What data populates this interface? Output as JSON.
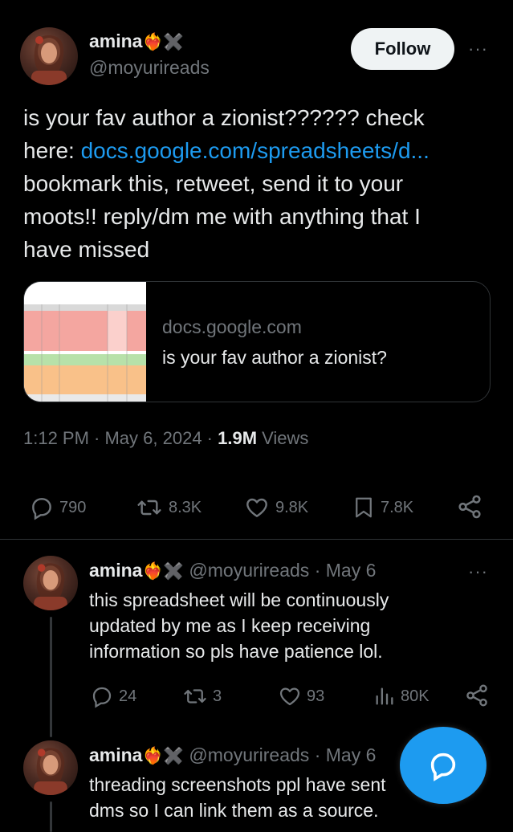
{
  "main_tweet": {
    "author_name": "amina",
    "author_emoji": "❤️‍🔥✖️",
    "handle": "@moyurireads",
    "follow_label": "Follow",
    "more_label": "···",
    "text_line1": "is your fav author a zionist?????? check",
    "text_line2_prefix": "here: ",
    "text_link": "docs.google.com/spreadsheets/d...",
    "text_line3": "bookmark this, retweet, send it to your",
    "text_line4": "moots!! reply/dm me with anything that I",
    "text_line5": "have missed",
    "card": {
      "domain": "docs.google.com",
      "title": "is your fav author a zionist?"
    },
    "time": "1:12 PM · May 6, 2024 · ",
    "views_count": "1.9M",
    "views_label": " Views",
    "stats": {
      "replies": "790",
      "retweets": "8.3K",
      "likes": "9.8K",
      "bookmarks": "7.8K"
    },
    "icons": [
      "reply-icon",
      "retweet-icon",
      "like-icon",
      "bookmark-icon",
      "share-icon"
    ]
  },
  "replies": [
    {
      "author_name": "amina",
      "author_emoji": "❤️‍🔥✖️",
      "handle_date": "@moyurireads · May 6",
      "more_label": "···",
      "line1": "this spreadsheet will be continuously",
      "line2": "updated by me as I keep receiving",
      "line3": "information so pls have patience lol.",
      "stats": {
        "replies": "24",
        "retweets": "3",
        "likes": "93",
        "views": "80K"
      }
    },
    {
      "author_name": "amina",
      "author_emoji": "❤️‍🔥✖️",
      "handle_date": "@moyurireads · May 6",
      "line1": "threading screenshots ppl have sent",
      "line2": "dms so I can link them as a source."
    }
  ],
  "colors": {
    "background": "#000000",
    "text": "#e7e9ea",
    "muted": "#71767b",
    "link": "#1d9bf0",
    "divider": "#2f3336"
  }
}
